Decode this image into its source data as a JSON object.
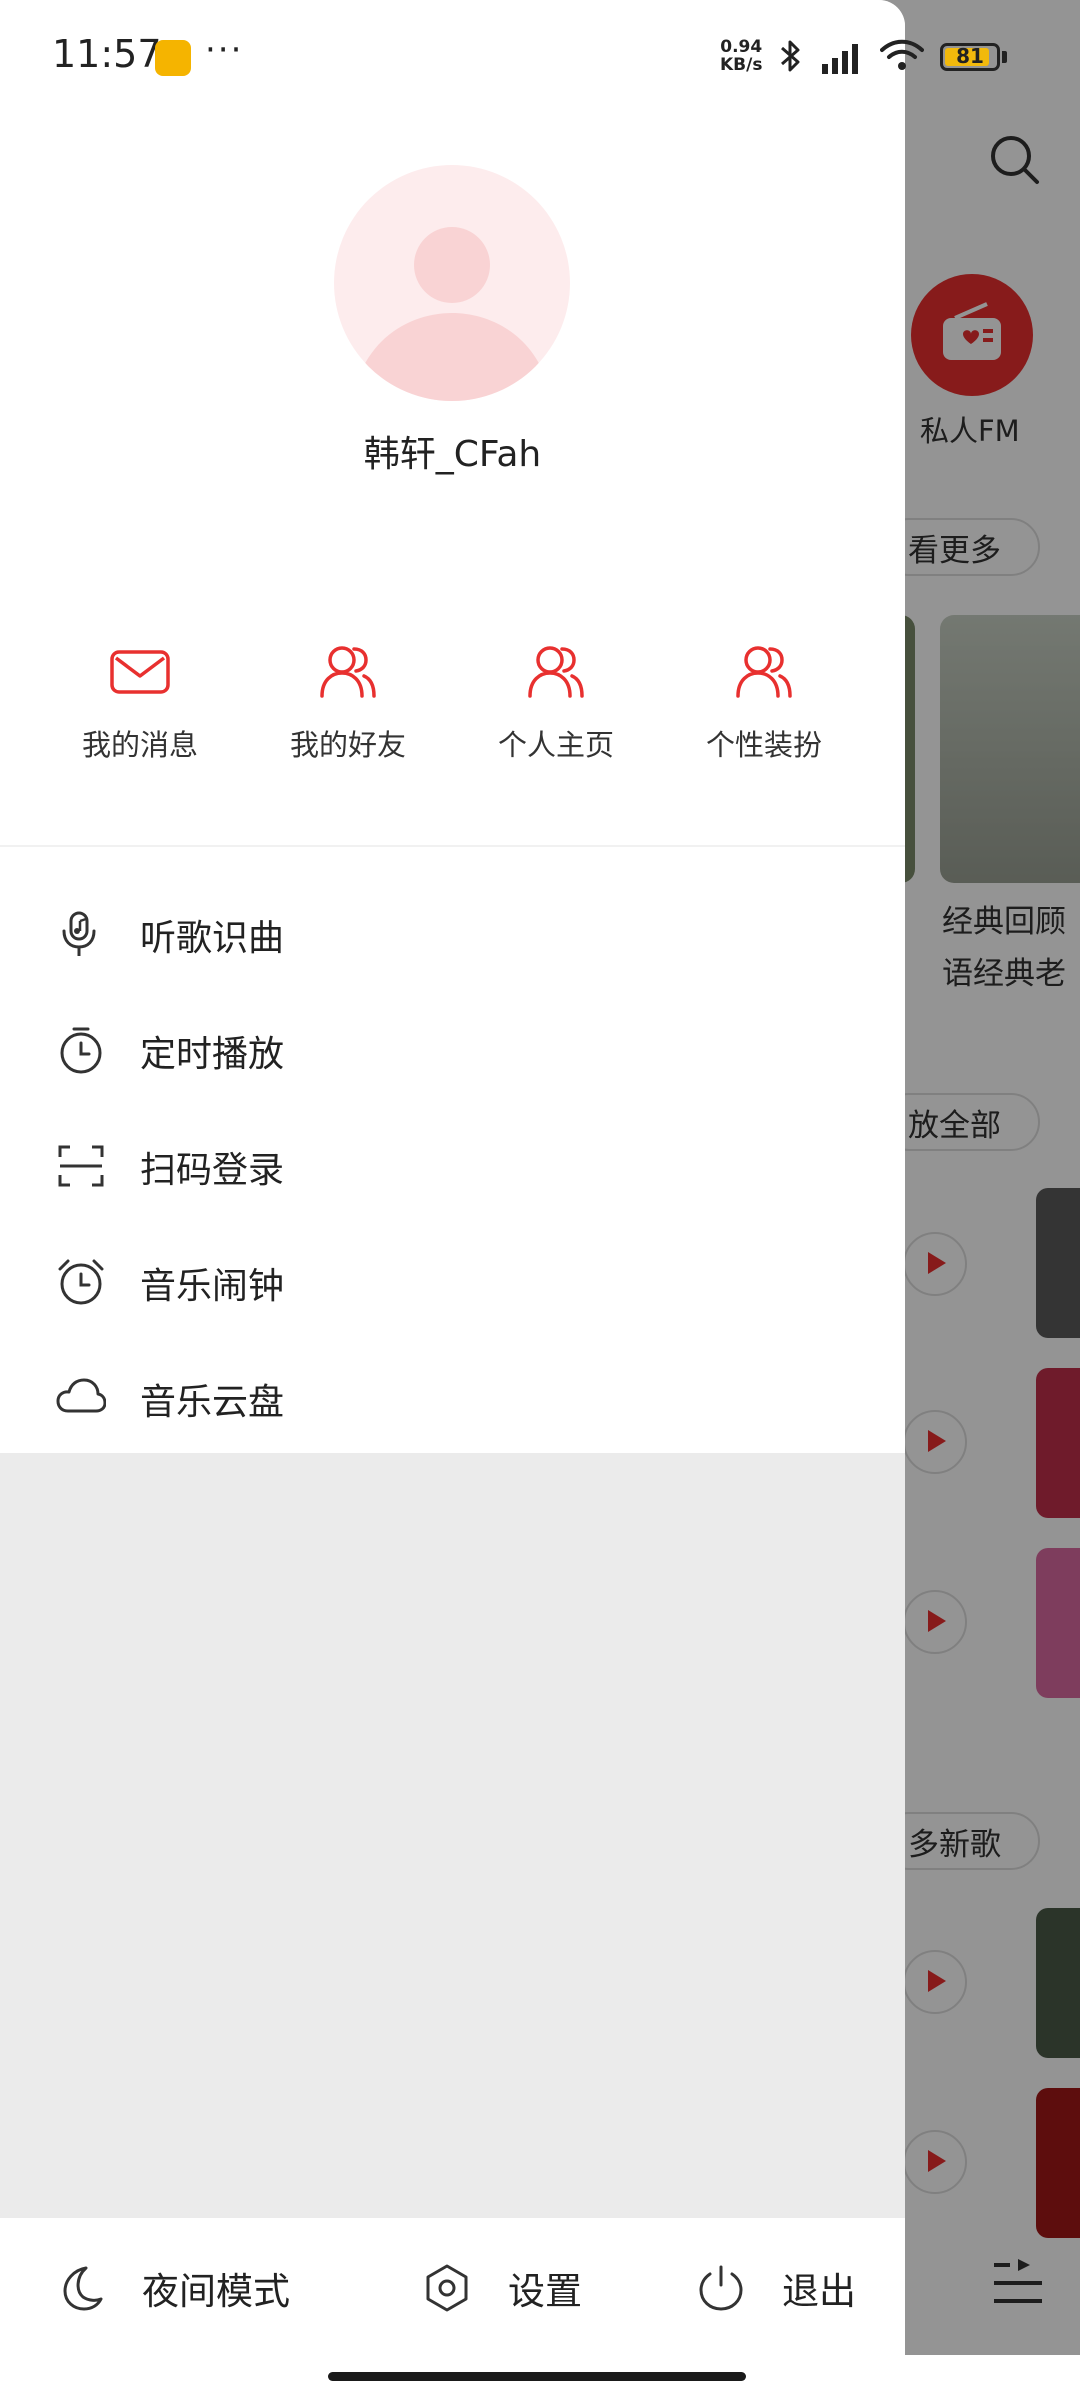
{
  "status_bar": {
    "time": "11:57",
    "more": "···",
    "net_speed_value": "0.94",
    "net_speed_unit": "KB/s",
    "battery": "81"
  },
  "background": {
    "fm_label": "私人FM",
    "see_more": "看更多",
    "card_title_line1": "经典回顾",
    "card_title_line2": "语经典老",
    "play_all": "放全部",
    "more_new_songs": "多新歌"
  },
  "drawer": {
    "username": "韩轩_CFah",
    "quick_actions": [
      {
        "label": "我的消息",
        "icon": "mail-icon"
      },
      {
        "label": "我的好友",
        "icon": "friends-icon"
      },
      {
        "label": "个人主页",
        "icon": "profile-icon"
      },
      {
        "label": "个性装扮",
        "icon": "theme-icon"
      }
    ],
    "menu": [
      {
        "label": "听歌识曲",
        "icon": "mic-music-icon"
      },
      {
        "label": "定时播放",
        "icon": "timer-icon"
      },
      {
        "label": "扫码登录",
        "icon": "scan-icon"
      },
      {
        "label": "音乐闹钟",
        "icon": "alarm-icon"
      },
      {
        "label": "音乐云盘",
        "icon": "cloud-icon"
      }
    ],
    "bottom": {
      "night_mode": "夜间模式",
      "settings": "设置",
      "logout": "退出"
    }
  },
  "colors": {
    "accent": "#e8302f",
    "avatar_bg": "#fdeced"
  }
}
